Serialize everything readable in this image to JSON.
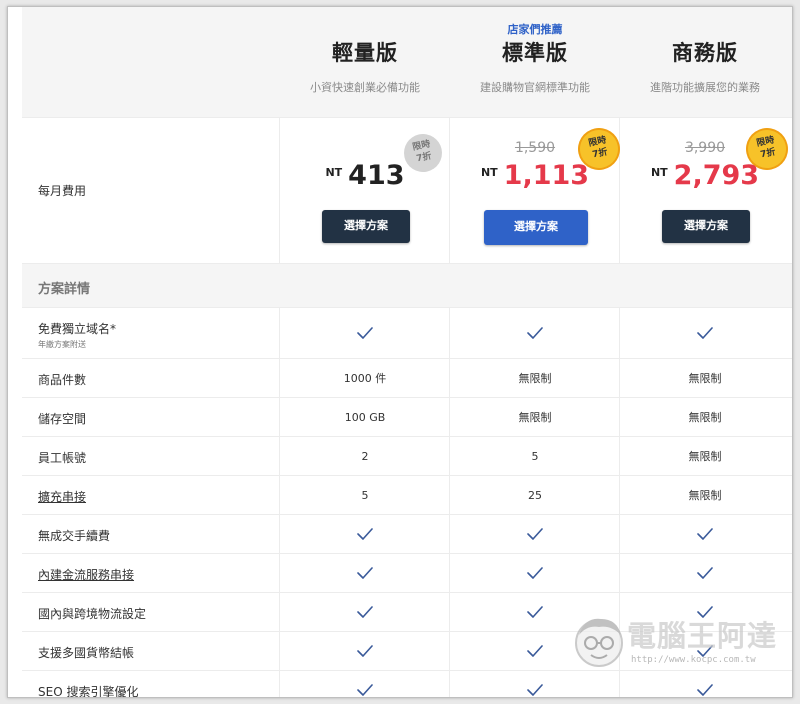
{
  "plans": [
    {
      "name": "輕量版",
      "desc": "小資快速創業必備功能",
      "recommend": "",
      "old_price": "",
      "currency": "NT",
      "price": "413",
      "badge_line1": "限時",
      "badge_line2": "7折",
      "button": "選擇方案"
    },
    {
      "name": "標準版",
      "desc": "建設購物官網標準功能",
      "recommend": "店家們推薦",
      "old_price": "1,590",
      "currency": "NT",
      "price": "1,113",
      "badge_line1": "限時",
      "badge_line2": "7折",
      "button": "選擇方案"
    },
    {
      "name": "商務版",
      "desc": "進階功能擴展您的業務",
      "recommend": "",
      "old_price": "3,990",
      "currency": "NT",
      "price": "2,793",
      "badge_line1": "限時",
      "badge_line2": "7折",
      "button": "選擇方案"
    }
  ],
  "price_row_label": "每月費用",
  "section_title": "方案詳情",
  "features": [
    {
      "label": "免費獨立域名*",
      "sub": "年繳方案附送",
      "values": [
        "✓",
        "✓",
        "✓"
      ]
    },
    {
      "label": "商品件數",
      "sub": "",
      "values": [
        "1000 件",
        "無限制",
        "無限制"
      ]
    },
    {
      "label": "儲存空間",
      "sub": "",
      "values": [
        "100 GB",
        "無限制",
        "無限制"
      ]
    },
    {
      "label": "員工帳號",
      "sub": "",
      "values": [
        "2",
        "5",
        "無限制"
      ]
    },
    {
      "label": "擴充串接",
      "sub": "",
      "values": [
        "5",
        "25",
        "無限制"
      ]
    },
    {
      "label": "無成交手續費",
      "sub": "",
      "values": [
        "✓",
        "✓",
        "✓"
      ]
    },
    {
      "label": "內建金流服務串接",
      "sub": "",
      "values": [
        "✓",
        "✓",
        "✓"
      ]
    },
    {
      "label": "國內與跨境物流設定",
      "sub": "",
      "values": [
        "✓",
        "✓",
        "✓"
      ]
    },
    {
      "label": "支援多國貨幣結帳",
      "sub": "",
      "values": [
        "✓",
        "✓",
        "✓"
      ]
    },
    {
      "label": "SEO 搜索引擎優化",
      "sub": "",
      "values": [
        "✓",
        "✓",
        "✓"
      ]
    }
  ],
  "watermark": {
    "text": "電腦王阿達",
    "url": "http://www.kocpc.com.tw"
  },
  "colors": {
    "accent": "#2f62c8",
    "dark_button": "#223244",
    "sale_red": "#e5394a",
    "badge_yellow": "#f7c229",
    "badge_gray": "#d4d4d4",
    "check": "#3a5a9a"
  }
}
